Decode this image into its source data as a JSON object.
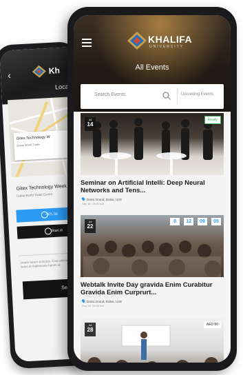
{
  "back_phone": {
    "header_title": "Kh",
    "header_sub": "Loca",
    "map_card_title": "Gitex Technology W",
    "map_card_sub": "Dubai World Trade",
    "place_title": "Gitex Technology Week",
    "place_address": "Dubai World Trade Centre",
    "primary_button": "+971 56",
    "secondary_button": "Start di",
    "info_text": "ornare lorem at lectus. Cras ultricies nibh metus netus et malesuada fames ac",
    "footer_button": "Seat"
  },
  "front_phone": {
    "brand": "KHALIFA",
    "brand_sub": "UNIVERSITY",
    "page_title": "All Events",
    "search_placeholder": "Search Events",
    "filter_selected": "Upcoming Events",
    "events": [
      {
        "month": "Jul",
        "day": "14",
        "tag": "Ready",
        "title": "Seminar on Artificial Intelli: Deep Neural Networks and Tens...",
        "location": "Dansi Grand, Dubai, UAE",
        "time": "Sep 18, 10:00 AM"
      },
      {
        "month": "Jul",
        "day": "22",
        "countdown": [
          "0",
          "12",
          "09",
          "05"
        ],
        "title": "Webtalk Invite Day gravida Enim Curabitur Gravida Enim Curprurt...",
        "location": "Dansi Grand, Dubai, UAE",
        "time": "Sep 18, 10:00 AM"
      },
      {
        "month": "Jul",
        "day": "28",
        "tag": "AED 80"
      }
    ]
  },
  "colors": {
    "accent_blue": "#2b9bf4",
    "ready_green": "#3fb05a",
    "dark": "#151515"
  }
}
